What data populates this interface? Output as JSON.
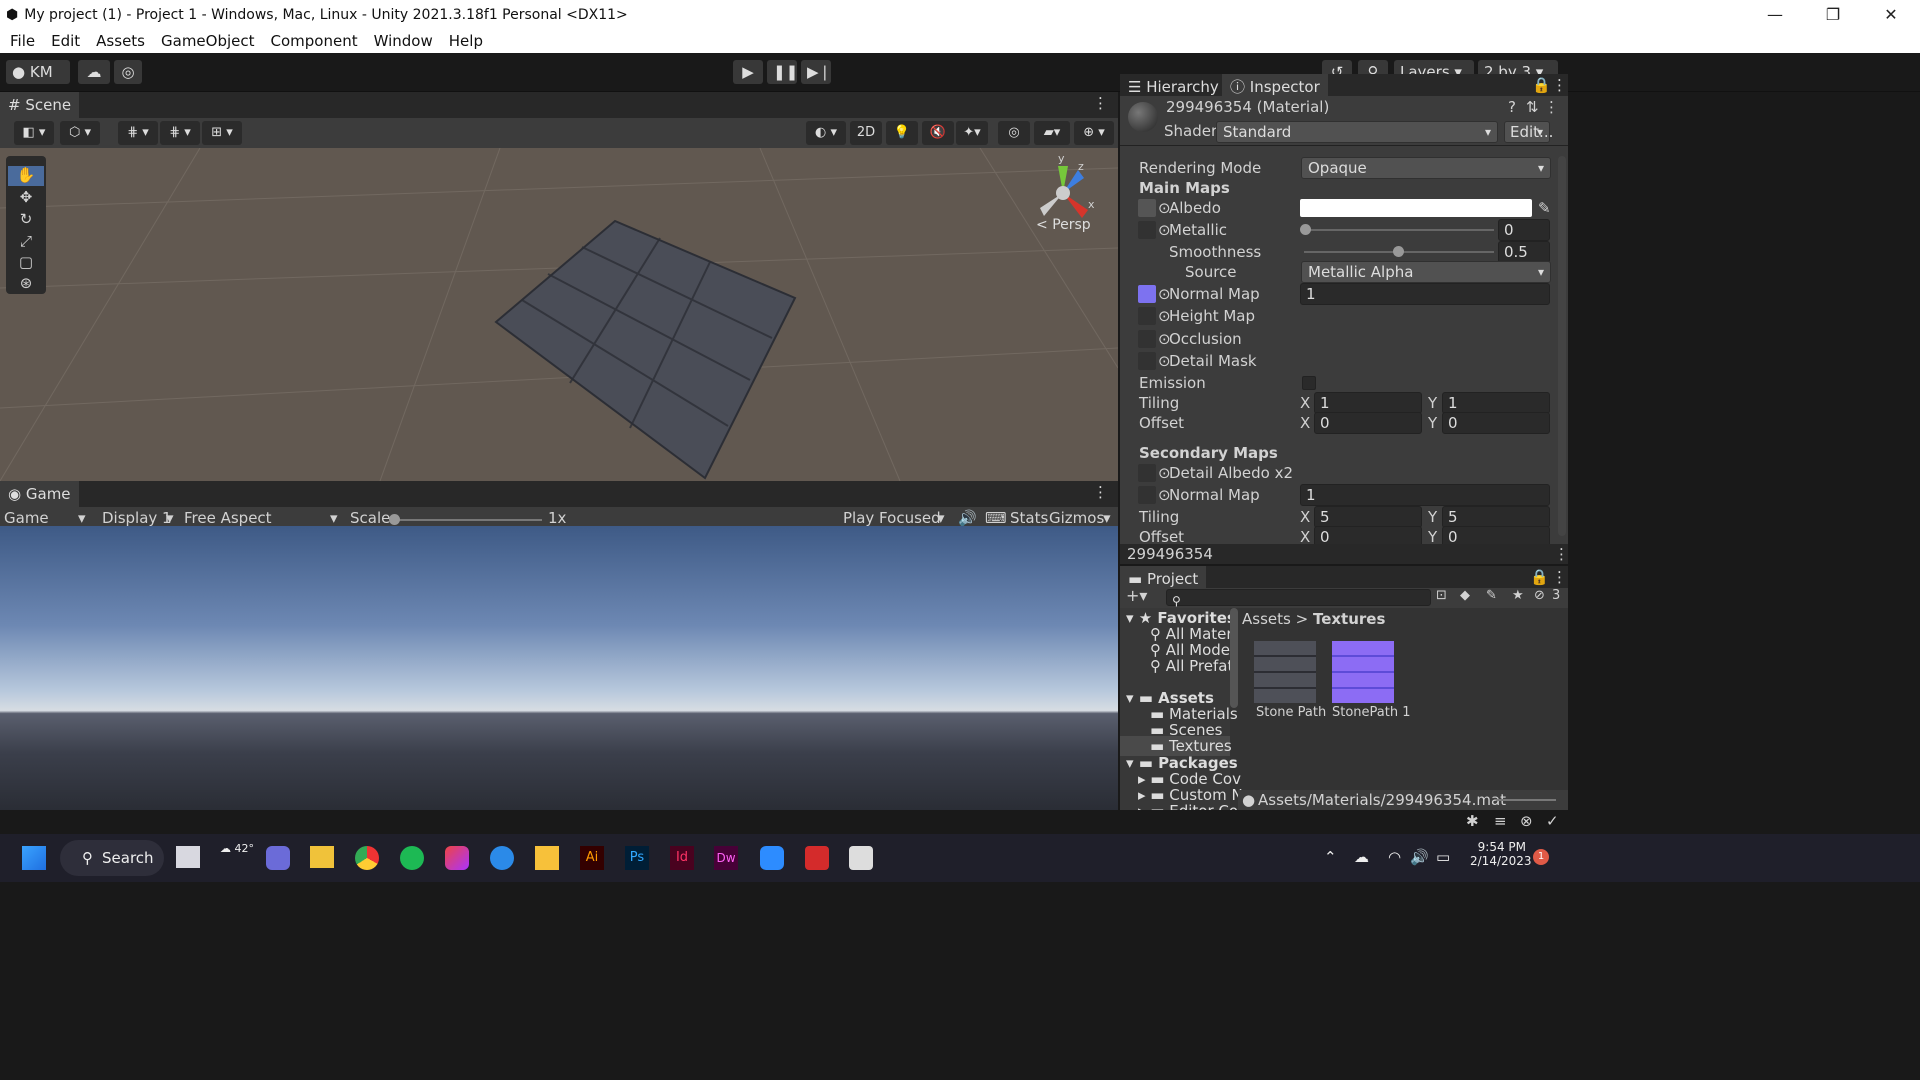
{
  "window": {
    "title": "My project (1) - Project 1 - Windows, Mac, Linux - Unity 2021.3.18f1 Personal <DX11>",
    "controls": [
      "—",
      "❐",
      "✕"
    ]
  },
  "menu": [
    "File",
    "Edit",
    "Assets",
    "GameObject",
    "Component",
    "Window",
    "Help"
  ],
  "toolbar": {
    "account": "KM",
    "layers": "Layers",
    "layout": "2 by 3"
  },
  "scene": {
    "tab": "Scene",
    "btn_2d": "2D",
    "persp": "Persp",
    "gizmo_y": "y",
    "gizmo_z": "z",
    "gizmo_x": "x"
  },
  "game": {
    "tab": "Game",
    "dropdown_game": "Game",
    "display": "Display 1",
    "aspect": "Free Aspect",
    "scale_label": "Scale",
    "scale_value": "1x",
    "play_focused": "Play Focused",
    "stats": "Stats",
    "gizmos": "Gizmos"
  },
  "inspector": {
    "tabs": [
      "Hierarchy",
      "Inspector"
    ],
    "object": "299496354 (Material)",
    "shader_label": "Shader",
    "shader": "Standard",
    "edit": "Edit...",
    "rendering_mode_label": "Rendering Mode",
    "rendering_mode": "Opaque",
    "main_maps": "Main Maps",
    "albedo": "Albedo",
    "metallic": "Metallic",
    "metallic_value": "0",
    "smoothness": "Smoothness",
    "smoothness_value": "0.5",
    "source": "Source",
    "source_value": "Metallic Alpha",
    "normal_map": "Normal Map",
    "normal_value": "1",
    "height_map": "Height Map",
    "occlusion": "Occlusion",
    "detail_mask": "Detail Mask",
    "emission": "Emission",
    "tiling": "Tiling",
    "offset": "Offset",
    "x": "X",
    "y": "Y",
    "tiling_x": "1",
    "tiling_y": "1",
    "offset_x": "0",
    "offset_y": "0",
    "secondary_maps": "Secondary Maps",
    "detail_albedo": "Detail Albedo x2",
    "normal_map2": "Normal Map",
    "normal2_value": "1",
    "tiling2_x": "5",
    "tiling2_y": "5",
    "offset2_x": "0",
    "offset2_y": "0",
    "footer": "299496354"
  },
  "project": {
    "tab": "Project",
    "hidden_count": "3",
    "breadcrumb_root": "Assets",
    "breadcrumb_sep": ">",
    "breadcrumb_current": "Textures",
    "favorites": "Favorites",
    "fav_items": [
      "All Materi",
      "All Model",
      "All Prefat"
    ],
    "assets": "Assets",
    "asset_folders": [
      "Materials",
      "Scenes",
      "Textures"
    ],
    "packages": "Packages",
    "package_folders": [
      "Code Cov",
      "Custom N",
      "Editor Co"
    ],
    "files": [
      "Stone Path",
      "StonePath 1"
    ],
    "path": "Assets/Materials/299496354.mat"
  },
  "taskbar": {
    "search": "Search",
    "weather": "42°",
    "time": "9:54 PM",
    "date": "2/14/2023",
    "notif": "1"
  }
}
